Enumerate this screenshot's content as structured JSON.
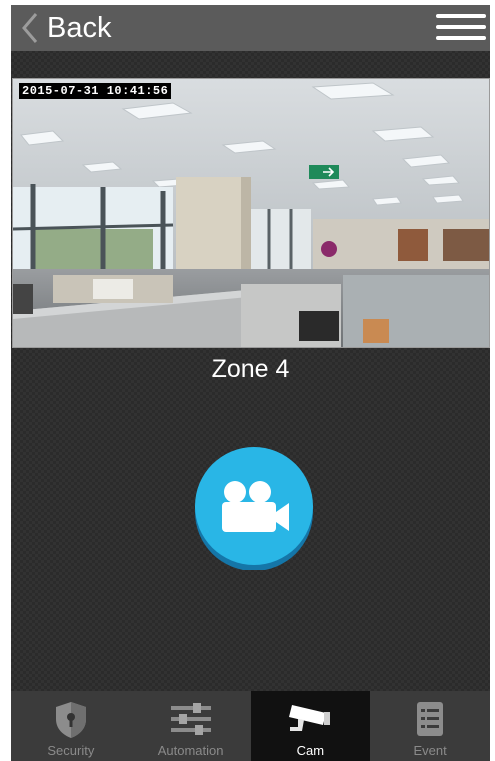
{
  "header": {
    "back_label": "Back",
    "back_icon": "chevron-left-icon",
    "menu_icon": "hamburger-menu-icon"
  },
  "camera": {
    "timestamp": "2015-07-31 10:41:56",
    "zone_title": "Zone 4"
  },
  "record_button": {
    "icon": "video-camera-icon"
  },
  "tabs": [
    {
      "label": "Security",
      "icon": "shield-keyhole-icon",
      "active": false
    },
    {
      "label": "Automation",
      "icon": "sliders-icon",
      "active": false
    },
    {
      "label": "Cam",
      "icon": "security-camera-icon",
      "active": true
    },
    {
      "label": "Event",
      "icon": "event-list-icon",
      "active": false
    }
  ],
  "colors": {
    "accent": "#29b6e6",
    "topbar": "#5b5b5b",
    "background": "#2b2b2b",
    "tabbar": "#3b3b3b",
    "tab_active": "#111111"
  }
}
